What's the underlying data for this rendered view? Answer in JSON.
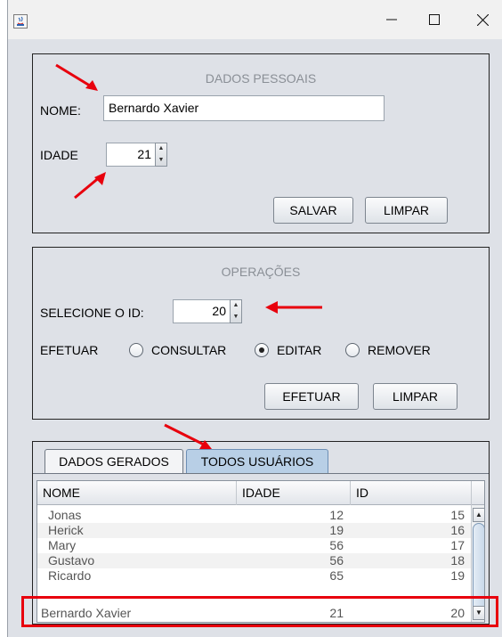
{
  "titlebar": {
    "app_icon": "java-icon",
    "minimize_icon": "minimize-icon",
    "maximize_icon": "maximize-icon",
    "close_icon": "close-icon"
  },
  "dados_pessoais": {
    "title": "DADOS PESSOAIS",
    "nome_label": "NOME:",
    "nome_value": "Bernardo Xavier",
    "idade_label": "IDADE",
    "idade_value": "21",
    "salvar_label": "SALVAR",
    "limpar_label": "LIMPAR"
  },
  "operacoes": {
    "title": "OPERAÇÕES",
    "id_label": "SELECIONE O ID:",
    "id_value": "20",
    "efetuar_label": "EFETUAR",
    "options": [
      "CONSULTAR",
      "EDITAR",
      "REMOVER"
    ],
    "selected_option": "EDITAR",
    "efetuar_button": "EFETUAR",
    "limpar_button": "LIMPAR"
  },
  "tabs": [
    {
      "label": "DADOS GERADOS",
      "active": false
    },
    {
      "label": "TODOS USUÁRIOS",
      "active": true
    }
  ],
  "table": {
    "columns": [
      "NOME",
      "IDADE",
      "ID"
    ],
    "rows": [
      [
        "Jonas",
        "12",
        "15"
      ],
      [
        "Herick",
        "19",
        "16"
      ],
      [
        "Mary",
        "56",
        "17"
      ],
      [
        "Gustavo",
        "56",
        "18"
      ],
      [
        "Ricardo",
        "65",
        "19"
      ],
      [
        "Bernardo Xavier",
        "21",
        "20"
      ]
    ]
  },
  "colors": {
    "annotation": "#e8000d",
    "active_tab": "#b8cfe6"
  }
}
